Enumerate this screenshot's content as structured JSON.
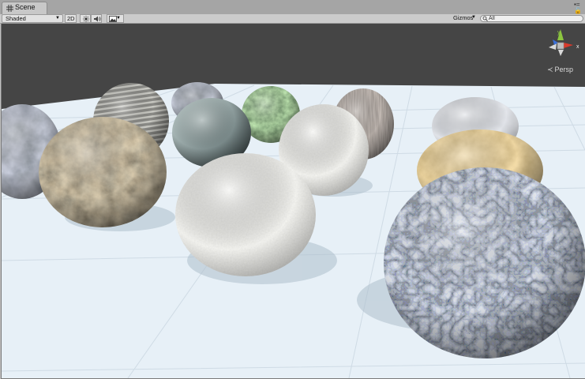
{
  "tab": {
    "title": "Scene"
  },
  "toolbar": {
    "shading_mode": "Shaded",
    "view_2d_label": "2D",
    "gizmos_label": "Gizmos",
    "search_placeholder": "All"
  },
  "gizmo": {
    "projection": "Persp",
    "axis_y": "y",
    "axis_x": "x"
  },
  "icons": {
    "scene_tab": "grid-icon",
    "lighting": "sun-icon",
    "audio": "speaker-icon",
    "effects": "image-icon",
    "search": "search-icon",
    "window_menu": "more-icon",
    "lock": "lock-icon"
  },
  "colors": {
    "background_dark": "#464646",
    "ground_plane": "#e7f0f7",
    "axis_x": "#d83a2c",
    "axis_y": "#8cc63f",
    "axis_z": "#3a6fd8"
  }
}
